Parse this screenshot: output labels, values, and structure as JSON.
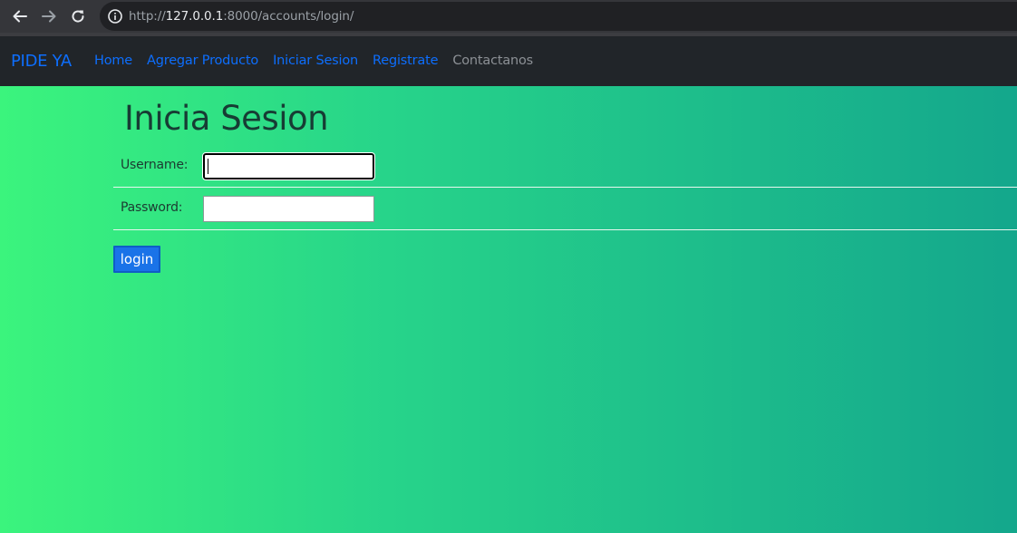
{
  "browser": {
    "url_prefix": "http://",
    "url_host": "127.0.0.1",
    "url_rest": ":8000/accounts/login/",
    "icons": [
      "back-arrow-icon",
      "forward-arrow-icon",
      "reload-icon",
      "info-icon"
    ]
  },
  "navbar": {
    "brand": "PIDE YA",
    "links": [
      {
        "label": "Home"
      },
      {
        "label": "Agregar Producto"
      },
      {
        "label": "Iniciar Sesion"
      },
      {
        "label": "Registrate"
      },
      {
        "label": "Contactanos"
      }
    ]
  },
  "page": {
    "title": "Inicia Sesion",
    "username_label": "Username:",
    "username_value": "",
    "password_label": "Password:",
    "password_value": "",
    "login_button": "login"
  },
  "colors": {
    "link": "#0d6efd",
    "navbar_bg": "#212529",
    "gradient_start": "#3bf47d",
    "gradient_end": "#14a78c",
    "button_bg": "#1a73e8"
  }
}
